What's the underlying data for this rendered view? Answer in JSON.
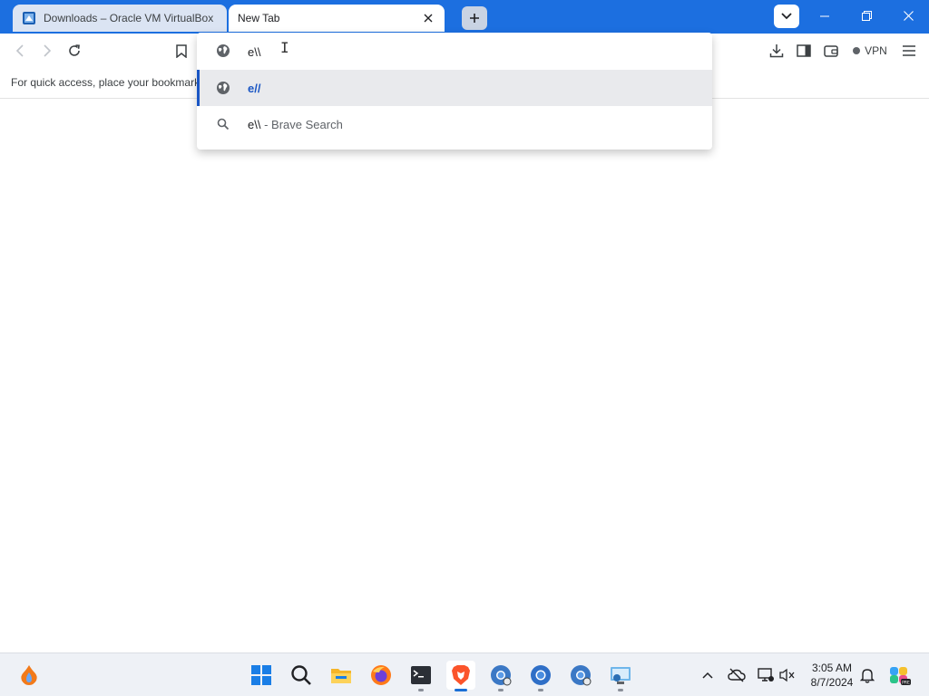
{
  "browser": {
    "tabs": [
      {
        "title": "Downloads – Oracle VM VirtualBox",
        "active": false
      },
      {
        "title": "New Tab",
        "active": true
      }
    ],
    "accent_color": "#1c6fe0"
  },
  "toolbar": {
    "vpn_label": "VPN"
  },
  "bookmarks_bar": {
    "hint": "For quick access, place your bookmarks"
  },
  "omnibox": {
    "input_value": "e\\\\",
    "suggestions": [
      {
        "text": "e//",
        "icon": "globe-icon",
        "selected": true
      },
      {
        "text": "e\\\\",
        "separator": " - ",
        "engine": "Brave Search",
        "icon": "search-icon",
        "selected": false
      }
    ]
  },
  "taskbar": {
    "apps": [
      "start-icon",
      "search-icon",
      "file-explorer-icon",
      "firefox-icon",
      "terminal-icon",
      "brave-icon",
      "chrome-canary-icon",
      "chrome-icon",
      "chrome-dev-icon",
      "remote-desktop-icon"
    ],
    "clock": {
      "time": "3:05 AM",
      "date": "8/7/2024"
    }
  }
}
